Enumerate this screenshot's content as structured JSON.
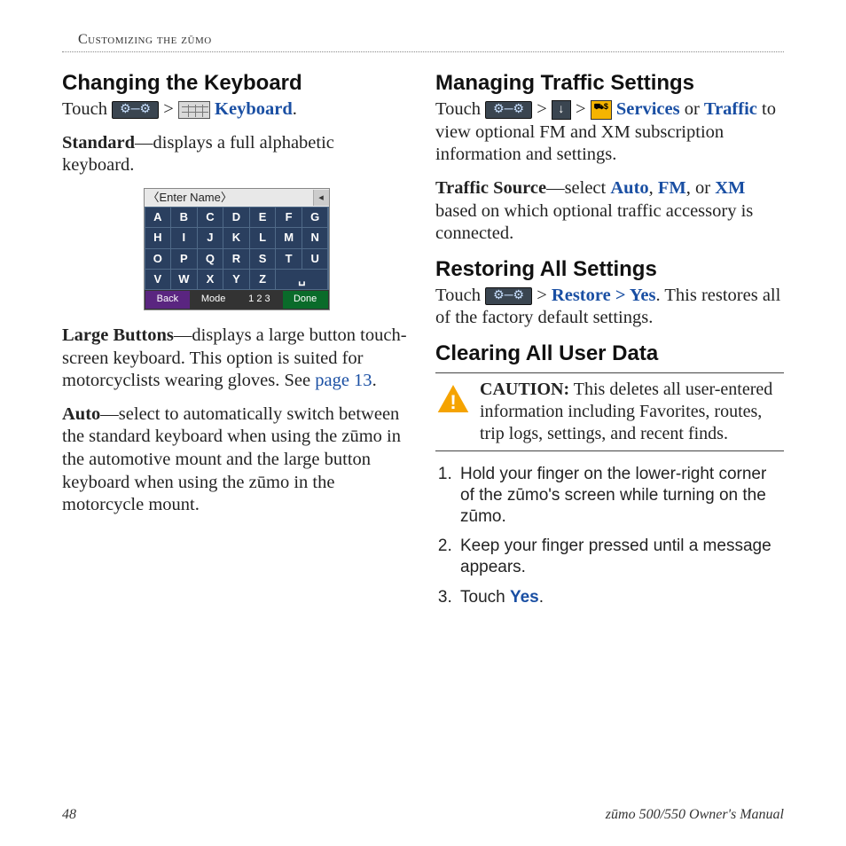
{
  "header": "Customizing the zūmo",
  "left": {
    "h1": "Changing the Keyboard",
    "p1_touch": "Touch ",
    "p1_kbd": " Keyboard",
    "p1_dot": ".",
    "p2_bold": "Standard",
    "p2_text": "—displays a full alphabetic keyboard.",
    "kbd_title": "〈Enter Name〉",
    "kbd_keys": [
      "A",
      "B",
      "C",
      "D",
      "E",
      "F",
      "G",
      "H",
      "I",
      "J",
      "K",
      "L",
      "M",
      "N",
      "O",
      "P",
      "Q",
      "R",
      "S",
      "T",
      "U",
      "V",
      "W",
      "X",
      "Y",
      "Z",
      "␣"
    ],
    "kbd_back": "Back",
    "kbd_mode": "Mode",
    "kbd_123": "1 2 3",
    "kbd_done": "Done",
    "p3_bold": "Large Buttons",
    "p3_text": "—displays a large button touch-screen keyboard. This option is suited for motorcyclists wearing gloves. See ",
    "p3_link": "page 13",
    "p3_dot": ".",
    "p4_bold": "Auto",
    "p4_text": "—select to automatically switch between the standard keyboard when using the zūmo in the automotive mount and the large button keyboard when using the zūmo in the motorcycle mount."
  },
  "right": {
    "h1": "Managing Traffic Settings",
    "r1_touch": "Touch ",
    "r1_svc": " Services",
    "r1_or": " or ",
    "r1_traf": "Traffic",
    "r1_rest": " to view optional FM and XM subscription information and settings.",
    "r2_bold": "Traffic Source",
    "r2_a": "—select ",
    "r2_auto": "Auto",
    "r2_c1": ", ",
    "r2_fm": "FM",
    "r2_c2": ", or ",
    "r2_xm": "XM",
    "r2_rest": " based on which optional traffic accessory is connected.",
    "h2": "Restoring All Settings",
    "r3_touch": "Touch ",
    "r3_rest": " Restore > Yes",
    "r3_dot": ". This restores all of the factory default settings.",
    "h3": "Clearing All User Data",
    "caution_bold": "CAUTION:",
    "caution_text": " This deletes all user-entered information including Favorites, routes, trip logs, settings, and recent finds.",
    "steps": [
      "Hold your finger on the lower-right corner of the zūmo's screen while turning on the zūmo.",
      "Keep your finger pressed until a message appears."
    ],
    "step3_a": "Touch ",
    "step3_yes": "Yes",
    "step3_dot": "."
  },
  "footer": {
    "page": "48",
    "manual": "zūmo 500/550 Owner's Manual"
  },
  "gt": ">"
}
